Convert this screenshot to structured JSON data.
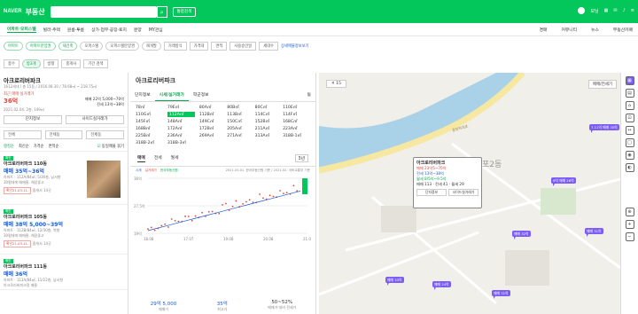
{
  "top": {
    "logo": "NAVER",
    "brand": "부동산",
    "complex_btn": "통합검색",
    "user": "모님",
    "icons": [
      "apps-icon",
      "mail-icon",
      "bell-icon",
      "menu-icon"
    ]
  },
  "nav": {
    "tabs": [
      "아파트·오피스텔",
      "빌라·주택",
      "원룸·투룸",
      "상가·업무·공장·토지",
      "분양",
      "MY관심"
    ],
    "right": [
      "경매",
      "커뮤니티",
      "뉴스",
      "부동산카페"
    ]
  },
  "filters": [
    "아파트",
    "아파트분양권",
    "재건축",
    "오피스텔",
    "오피스텔분양권",
    "재개발",
    "거래방식",
    "가격대",
    "면적",
    "사용승인일",
    "세대수"
  ],
  "filter_extra": "상세매물정보보기",
  "filters2": [
    "층수",
    "방3개",
    "방향",
    "중개사",
    "기간 검색"
  ],
  "complex": {
    "name": "아크로리버파크",
    "meta": "1612세대 / 총 15동 / 2016.08.30 / 78.68㎡ ~ 218.75㎡",
    "deal_label": "최근 매매 실거래가",
    "deal_price": "36억",
    "deal_date": "2021.02.04, 2층, 149㎡",
    "sell_range": "매매 22억 5,000~70억",
    "rent_range": "전세 13억~38억",
    "btn_info": "단지정보",
    "btn_actual": "사이드실거래가"
  },
  "sorts": [
    "랭킹순",
    "최신순",
    "가격순",
    "면적순"
  ],
  "same_listing": "동일매물 묶기",
  "dong_filters": [
    "전체",
    "전체동",
    "전체동"
  ],
  "listings": [
    {
      "tag": "확인",
      "title": "아크로리버파크 110동",
      "price": "매매 35억~36억",
      "desc": "아파트 · 112A/84㎡, 5/30층, 남서향",
      "desc2": "30평대에 매매물. 채광좋고",
      "agent": "확인21.03.11.",
      "count": "중개사 14곳"
    },
    {
      "tag": "확인",
      "title": "아크로리버파크 105동",
      "price": "매매 38억 5,000~39억",
      "desc": "아파트 · 112B/84㎡, 12/30층, 북향",
      "desc2": "30평대에 매매물. 채광좋고",
      "agent": "확인21.03.11.",
      "count": "중개사 14곳"
    },
    {
      "tag": "확인",
      "title": "아크로리버파크 111동",
      "price": "매매 36억",
      "desc": "아파트 · 112A/84㎡, 11/22층, 남서향",
      "desc2": "아크로리버파크정 매물",
      "agent": "확인21.03.11.",
      "count": ""
    }
  ],
  "mid": {
    "title": "아크로리버파크",
    "tabs": [
      "단지정보",
      "시세/실거래가",
      "학군정보"
    ],
    "more": "동",
    "areas": [
      "78㎡",
      "79E㎡",
      "80A㎡",
      "80B㎡",
      "80C㎡",
      "110E㎡",
      "110G㎡",
      "112A㎡",
      "112B㎡",
      "113B㎡",
      "114C㎡",
      "114F㎡",
      "145F㎡",
      "148A㎡",
      "149C㎡",
      "150C㎡",
      "152B㎡",
      "168C㎡",
      "168B㎡",
      "172A㎡",
      "172B㎡",
      "205A㎡",
      "211A㎡",
      "223A㎡",
      "225B㎡",
      "236A㎡",
      "269A㎡",
      "271A㎡",
      "313A㎡",
      "318B-1㎡",
      "318B-2㎡",
      "318B-3㎡"
    ],
    "selected_area": "112A㎡",
    "price_tabs": [
      "매매",
      "전세",
      "월세"
    ],
    "period": "3년",
    "legend": [
      "시세",
      "실거래가",
      "한국부동산원"
    ],
    "source": "2021.03.01. 한국부동산원 기준 / 2021.02. 국토교통부 기준",
    "stats": [
      {
        "v": "29억 5,000",
        "l": "매매가"
      },
      {
        "v": "35억",
        "l": "최고가"
      },
      {
        "v": "50~52%",
        "l": "매매가 대비 전세가"
      }
    ]
  },
  "chart_data": {
    "type": "scatter",
    "x_ticks": [
      "18.08",
      "17.07",
      "19.08",
      "20.08",
      "21.03"
    ],
    "y_ticks": [
      "36억",
      "27.5억",
      "19억"
    ],
    "ylim": [
      19,
      36
    ]
  },
  "map": {
    "zoom": "15",
    "road": "올림픽대로",
    "area_label": "포2동",
    "map_type": "매매/전세기",
    "markers": [
      "7.11억 매매 35억",
      "9억 매매 26억",
      "매매 33억",
      "매매 24억",
      "매매 31억",
      "매매 31억",
      "매매 32억"
    ],
    "popup": {
      "name": "아크로리버파크",
      "sale": "매매 23억5~70억",
      "jeonse": "전세 13억~38억",
      "monthly": "월세 8/5억~9.5억",
      "counts": "매매 113 · 전세 41 · 월세 29",
      "b1": "단지정보",
      "b2": "사이드실거래가"
    }
  },
  "tools": [
    "지도",
    "단지",
    "학교",
    "교통",
    "거리",
    "면적",
    "로드뷰",
    "위성",
    "현위치",
    "+",
    "−"
  ]
}
